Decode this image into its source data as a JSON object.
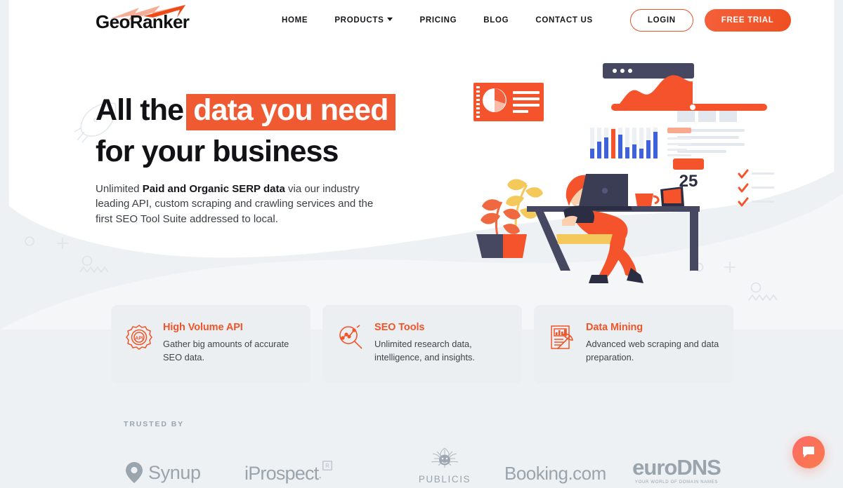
{
  "brand": {
    "name": "GeoRanker",
    "accent": "#ef5529",
    "accent_dark": "#e8532a",
    "highlight_bg": "#f05a33",
    "page_bg": "#eef1f4"
  },
  "header": {
    "nav": [
      {
        "label": "HOME",
        "has_caret": false
      },
      {
        "label": "PRODUCTS",
        "has_caret": true
      },
      {
        "label": "PRICING",
        "has_caret": false
      },
      {
        "label": "BLOG",
        "has_caret": false
      },
      {
        "label": "CONTACT US",
        "has_caret": false
      }
    ],
    "login_label": "LOGIN",
    "trial_label": "FREE TRIAL"
  },
  "hero": {
    "headline_part1": "All the",
    "headline_highlight": "data you need",
    "headline_line2": "for your business",
    "sub_pre": "Unlimited ",
    "sub_bold": "Paid and Organic SERP data",
    "sub_post": " via our industry leading API, custom scraping and crawling services and the first SEO Tool Suite addressed to local.",
    "illustration_badge_number": "25"
  },
  "cards": [
    {
      "icon": "api-gear-icon",
      "icon_label": "API",
      "title": "High Volume API",
      "desc": "Gather big amounts of accurate SEO data."
    },
    {
      "icon": "seo-magnifier-icon",
      "icon_label": "",
      "title": "SEO Tools",
      "desc": "Unlimited research data, intelligence, and insights."
    },
    {
      "icon": "data-mining-pickaxe-icon",
      "icon_label": "",
      "title": "Data Mining",
      "desc": "Advanced web scraping and data preparation."
    }
  ],
  "trusted": {
    "label": "TRUSTED BY",
    "logos": [
      {
        "name": "Synup",
        "icon": "map-pin-icon",
        "tagline": ""
      },
      {
        "name": "iProspect",
        "icon": "registered-mark-icon",
        "tagline": ""
      },
      {
        "name": "PUBLICIS",
        "icon": "publicis-crest-icon",
        "tagline": ""
      },
      {
        "name": "Booking.com",
        "icon": "",
        "tagline": ""
      },
      {
        "name": "euroDNS",
        "icon": "",
        "tagline": "YOUR WORLD OF DOMAIN NAMES"
      }
    ]
  },
  "chat": {
    "icon": "chat-bubble-icon",
    "label": "Open chat"
  }
}
